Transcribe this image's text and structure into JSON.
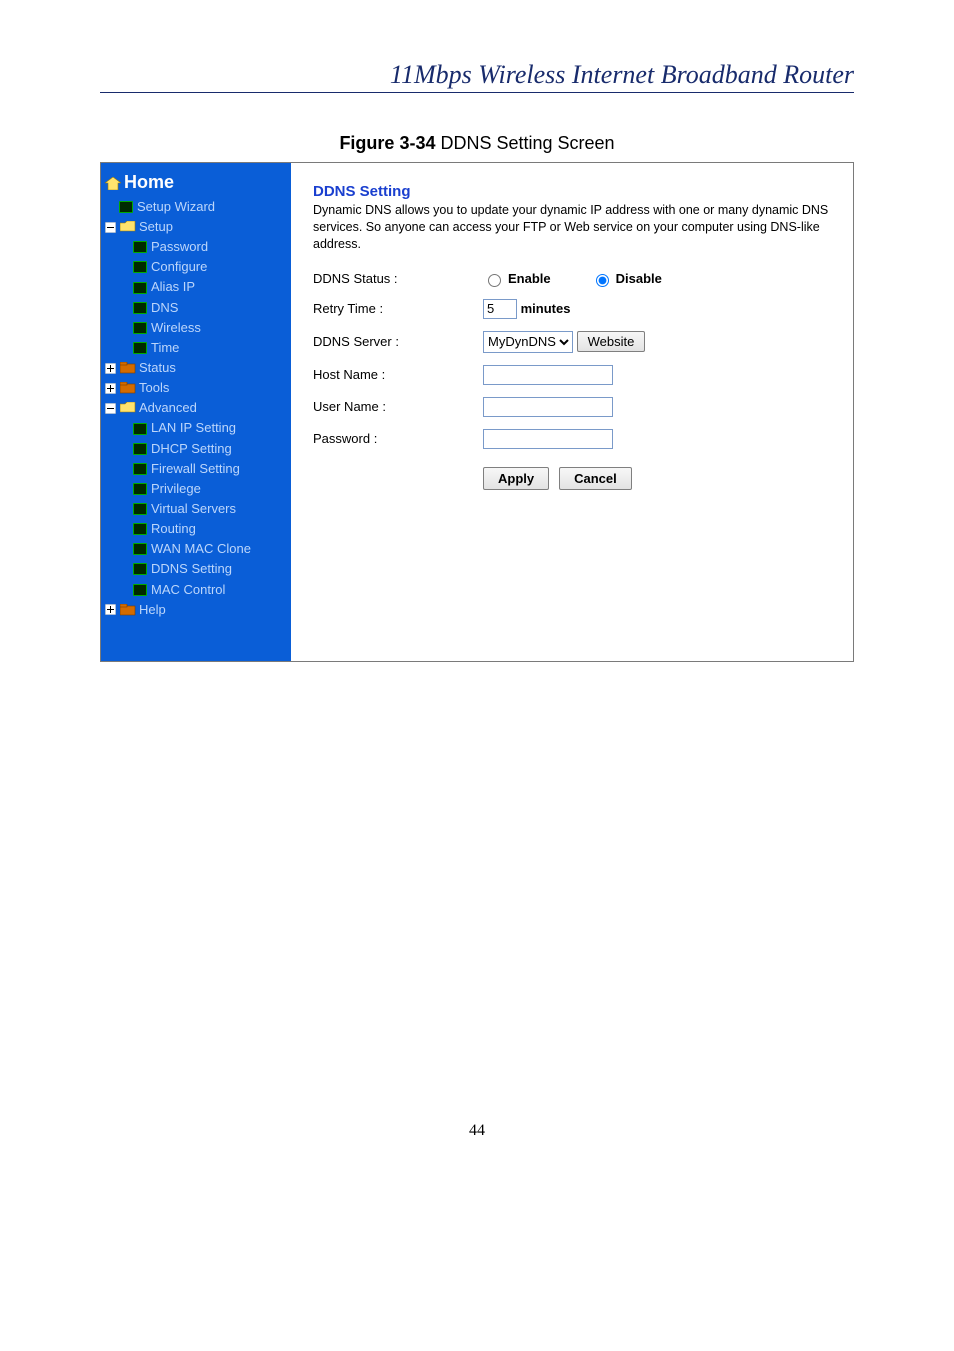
{
  "doc_title": "11Mbps  Wireless  Internet  Broadband  Router",
  "figure_caption_bold": "Figure 3-34",
  "figure_caption_rest": " DDNS Setting Screen",
  "page_number": "44",
  "sidebar": {
    "home": "Home",
    "setup_wizard": "Setup Wizard",
    "setup": "Setup",
    "password": "Password",
    "configure": "Configure",
    "alias_ip": "Alias IP",
    "dns": "DNS",
    "wireless": "Wireless",
    "time": "Time",
    "status": "Status",
    "tools": "Tools",
    "advanced": "Advanced",
    "lan_ip": "LAN IP Setting",
    "dhcp": "DHCP Setting",
    "firewall": "Firewall Setting",
    "privilege": "Privilege",
    "virtual_servers": "Virtual Servers",
    "routing": "Routing",
    "wan_mac": "WAN MAC Clone",
    "ddns": "DDNS Setting",
    "mac_control": "MAC Control",
    "help": "Help"
  },
  "content": {
    "heading": "DDNS Setting",
    "description": "Dynamic DNS allows you to update your dynamic IP address with one or many dynamic DNS services. So anyone can access your FTP or Web service on your computer using DNS-like address.",
    "labels": {
      "status": "DDNS Status :",
      "retry": "Retry Time :",
      "server": "DDNS Server :",
      "host": "Host Name :",
      "user": "User Name :",
      "password": "Password :",
      "minutes": "minutes"
    },
    "radio": {
      "enable": "Enable",
      "disable": "Disable"
    },
    "retry_value": "5",
    "server_select": "MyDynDNS",
    "website_btn": "Website",
    "apply": "Apply",
    "cancel": "Cancel"
  }
}
